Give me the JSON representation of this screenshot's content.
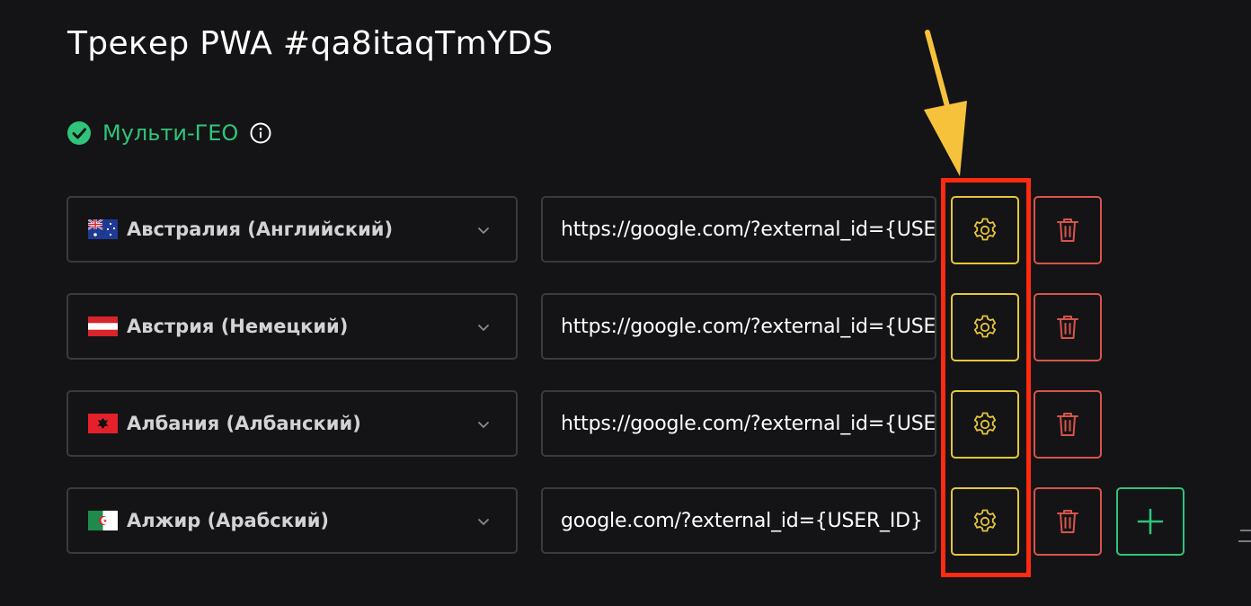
{
  "header": {
    "title": "Трекер PWA #qa8itaqTmYDS"
  },
  "multigeo": {
    "label": "Мульти-ГЕО",
    "accent": "#2fc47a"
  },
  "rows": [
    {
      "flag": "australia-flag",
      "country": "Австралия (Английский)",
      "url": "https://google.com/?external_id={USER_ID}"
    },
    {
      "flag": "austria-flag",
      "country": "Австрия (Немецкий)",
      "url": "https://google.com/?external_id={USER_ID}"
    },
    {
      "flag": "albania-flag",
      "country": "Албания (Албанский)",
      "url": "https://google.com/?external_id={USER_ID}"
    },
    {
      "flag": "algeria-flag",
      "country": "Алжир (Арабский)",
      "url": "google.com/?external_id={USER_ID}"
    }
  ],
  "icons": {
    "gear": "gear-icon",
    "trash": "trash-icon",
    "add": "plus-icon",
    "chevron": "chevron-down-icon",
    "check": "check-circle-icon",
    "info": "info-icon"
  },
  "colors": {
    "background": "#141416",
    "gear_border": "#e6c63a",
    "trash_border": "#d8544c",
    "add_border": "#2fc47a",
    "annotation_box": "#ff2a10",
    "annotation_arrow": "#f7c23b"
  }
}
